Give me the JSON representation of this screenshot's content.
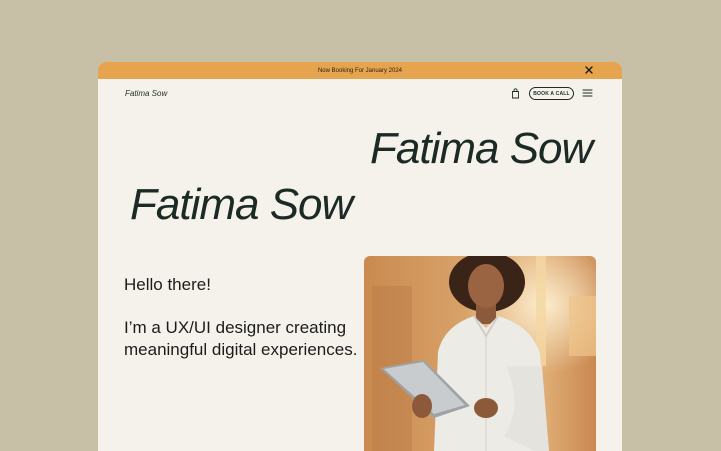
{
  "announcement": {
    "text": "Now Booking For January 2024",
    "close_icon": "close-icon"
  },
  "nav": {
    "brand": "Fatima Sow",
    "bag_icon": "shopping-bag-icon",
    "cta_label": "BOOK A CALL",
    "menu_icon": "hamburger-menu-icon"
  },
  "hero": {
    "name_line_1": "Fatima Sow",
    "name_line_2": "Fatima Sow"
  },
  "about": {
    "greeting": "Hello there!",
    "intro": "I’m a UX/UI designer creating meaningful digital experiences."
  },
  "colors": {
    "page_background": "#c8bfa7",
    "banner": "#e6a44e",
    "surface": "#f4f2ea",
    "heading_text": "#1b2a24"
  }
}
